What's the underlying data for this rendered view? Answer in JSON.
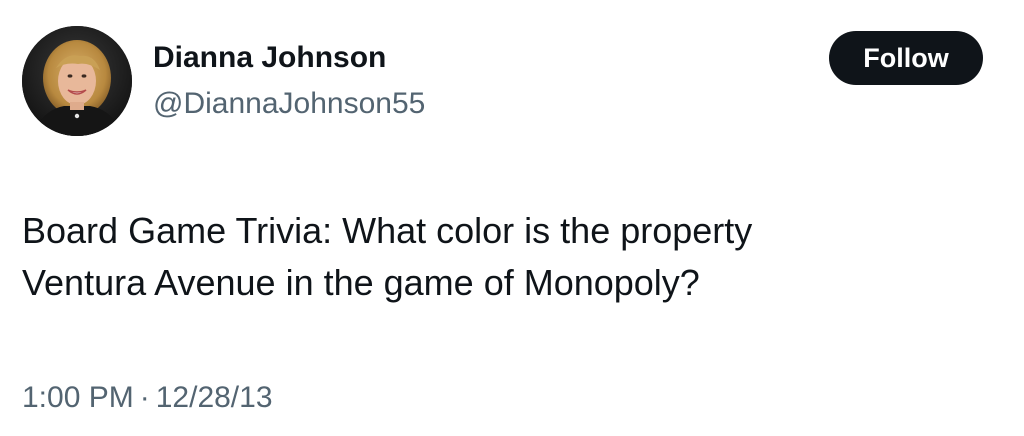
{
  "tweet": {
    "author": {
      "name": "Dianna Johnson",
      "handle": "@DiannaJohnson55"
    },
    "follow_label": "Follow",
    "text_line_1": "Board Game Trivia: What color is the property",
    "text_line_2": "Ventura Avenue in the game of Monopoly?",
    "time": "1:00 PM",
    "separator": "·",
    "date": "12/28/13"
  },
  "colors": {
    "text_primary": "#0f1419",
    "text_secondary": "#536471",
    "button_bg": "#0f1419",
    "button_text": "#ffffff",
    "background": "#ffffff"
  }
}
